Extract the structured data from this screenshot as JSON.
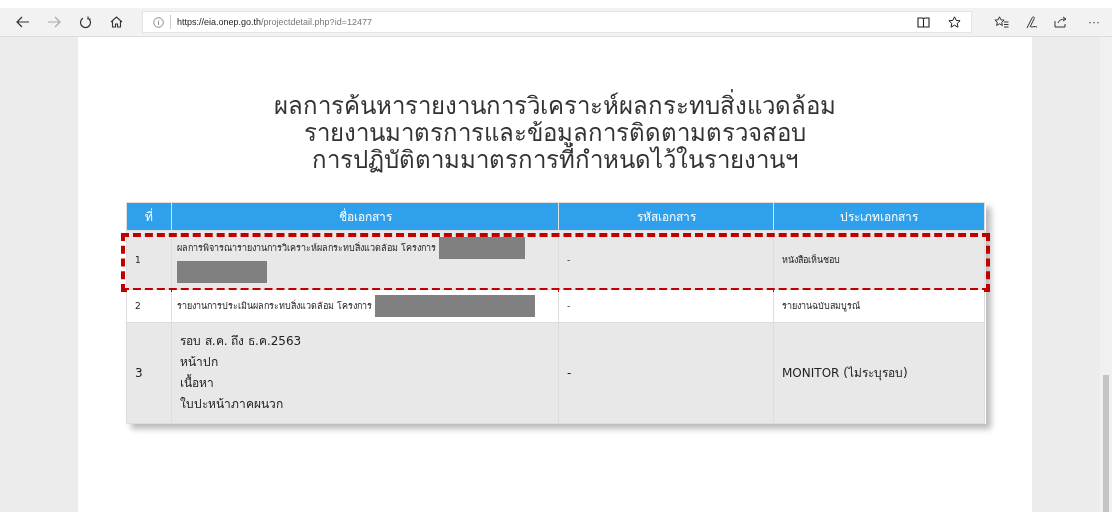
{
  "browser": {
    "url_host": "https://eia.onep.go.th",
    "url_path": "/projectdetail.php?id=12477",
    "forward_disabled": true,
    "more": "···"
  },
  "heading": [
    "ผลการค้นหารายงานการวิเคราะห์ผลกระทบสิ่งแวดล้อม",
    "รายงานมาตรการและข้อมูลการติดตามตรวจสอบ",
    "การปฏิบัติตามมาตรการที่กำหนดไว้ในรายงานฯ"
  ],
  "table": {
    "columns": [
      "ที่",
      "ชื่อเอกสาร",
      "รหัสเอกสาร",
      "ประเภทเอกสาร"
    ],
    "rows": [
      {
        "kind": "single",
        "no": "1",
        "name_lines": [
          "ผลการพิจารณารายงานการวิเคราะห์ผลกระทบสิ่งแวดล้อม โครงการ"
        ],
        "redactions": [
          {
            "kind": "wide"
          },
          {
            "kind": "short"
          }
        ],
        "code": "-",
        "type": "หนังสือเห็นชอบ",
        "annotated": true
      },
      {
        "kind": "single",
        "no": "2",
        "name_lines": [
          "รายงานการประเมินผลกระทบสิ่งแวดล้อม โครงการ"
        ],
        "redactions": [
          {
            "kind": "long"
          }
        ],
        "code": "-",
        "type": "รายงานฉบับสมบูรณ์",
        "annotated": false
      },
      {
        "kind": "multiline",
        "no": "3",
        "name_lines": [
          "รอบ ส.ค. ถึง ธ.ค.2563",
          "หน้าปก",
          "เนื้อหา",
          "ใบปะหน้าภาคผนวก"
        ],
        "code": "-",
        "type": "MONITOR (ไม่ระบุรอบ)",
        "annotated": false
      }
    ]
  }
}
